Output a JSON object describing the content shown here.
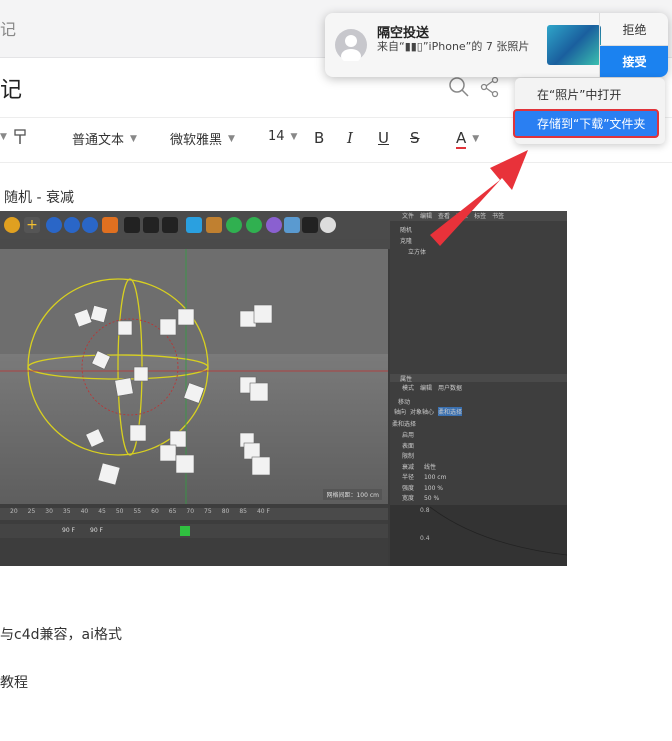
{
  "app": {
    "title_fragment": "记"
  },
  "note": {
    "title_fragment": "记"
  },
  "toolbar": {
    "style": "普通文本",
    "font": "微软雅黑",
    "size": "14",
    "bold": "B",
    "italic": "I",
    "underline": "U",
    "strike": "S",
    "color": "A"
  },
  "content": {
    "heading": "随机 - 衰减",
    "line1": "与c4d兼容，ai格式",
    "line2": "教程"
  },
  "c4d": {
    "panel_tabs": [
      "文件",
      "编辑",
      "查看",
      "对象",
      "标签",
      "书签"
    ],
    "objects": [
      "随机",
      "克隆",
      "立方体"
    ],
    "attr_title": "属性",
    "attr_tabs": [
      "模式",
      "编辑",
      "用户数据"
    ],
    "move_label": "移动",
    "sub_tabs": [
      "轴向",
      "对象轴心",
      "柔和选择"
    ],
    "section": "柔和选择",
    "rows": [
      "启用",
      "表面",
      "限制",
      "衰减",
      "半径",
      "强度",
      "宽度"
    ],
    "row_values": [
      "",
      "",
      "",
      "线性",
      "100 cm",
      "100 %",
      "50 %"
    ],
    "grid_label": "网格间距：100 cm",
    "frames": [
      "20",
      "25",
      "30",
      "35",
      "40",
      "45",
      "50",
      "55",
      "60",
      "65",
      "70",
      "75",
      "80",
      "85",
      "40 F"
    ],
    "frame_a": "90 F",
    "frame_b": "90 F",
    "graph_labels": [
      "0.8",
      "0.4"
    ]
  },
  "notification": {
    "title": "隔空投送",
    "body": "来自“▮▮▯”iPhone”的 7 张照片",
    "reject": "拒绝",
    "accept": "接受"
  },
  "menu": {
    "open_in_photos": "在“照片”中打开",
    "save_downloads": "存储到“下载”文件夹"
  },
  "colors": {
    "accent": "#1b82f0",
    "highlight_border": "#e0333a",
    "arrow": "#e8323a"
  }
}
